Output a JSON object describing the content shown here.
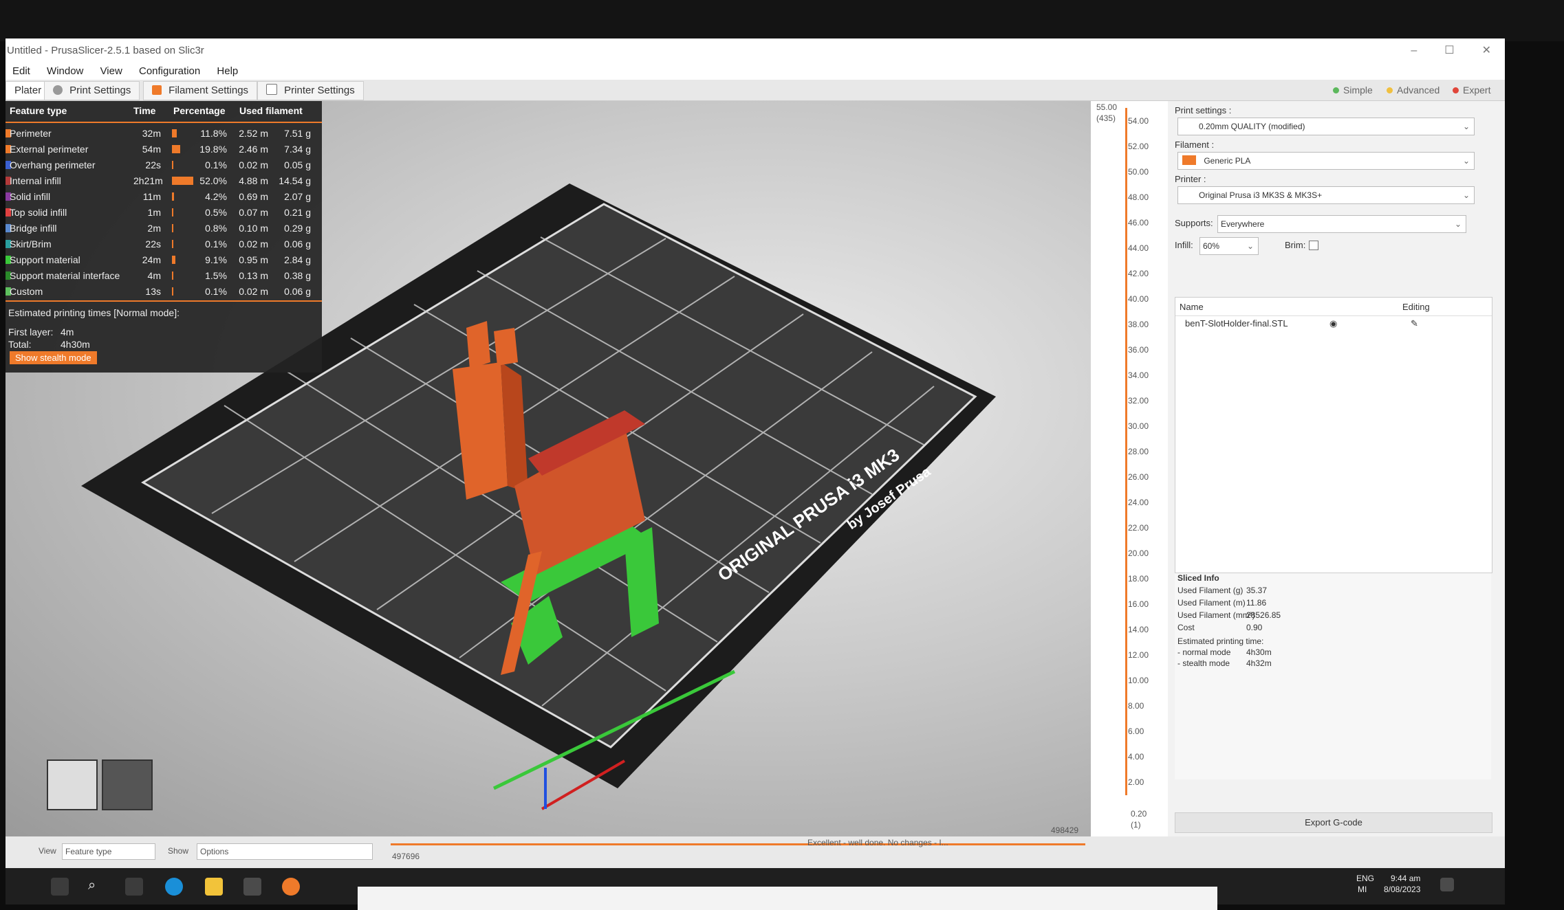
{
  "window": {
    "title": "Untitled - PrusaSlicer-2.5.1 based on Slic3r",
    "controls": [
      "–",
      "☐",
      "✕"
    ]
  },
  "menu": [
    "Edit",
    "Window",
    "View",
    "Configuration",
    "Help"
  ],
  "tabs": {
    "plater": "Plater",
    "print_settings": "Print Settings",
    "filament_settings": "Filament Settings",
    "printer_settings": "Printer Settings"
  },
  "modes": {
    "simple": "Simple",
    "advanced": "Advanced",
    "expert": "Expert",
    "colors": {
      "simple": "#5cb85c",
      "advanced": "#f0c040",
      "expert": "#e0463a"
    }
  },
  "stats": {
    "headers": {
      "type": "Feature type",
      "time": "Time",
      "percentage": "Percentage",
      "used_filament": "Used filament"
    },
    "rows": [
      {
        "name": "Perimeter",
        "time": "32m",
        "pct": "11.8%",
        "pct_value": 11.8,
        "len": "2.52 m",
        "wt": "7.51 g",
        "color": "#ef7a2a"
      },
      {
        "name": "External perimeter",
        "time": "54m",
        "pct": "19.8%",
        "pct_value": 19.8,
        "len": "2.46 m",
        "wt": "7.34 g",
        "color": "#ef7a2a"
      },
      {
        "name": "Overhang perimeter",
        "time": "22s",
        "pct": "0.1%",
        "pct_value": 0.1,
        "len": "0.02 m",
        "wt": "0.05 g",
        "color": "#3a5fd0"
      },
      {
        "name": "Internal infill",
        "time": "2h21m",
        "pct": "52.0%",
        "pct_value": 52.0,
        "len": "4.88 m",
        "wt": "14.54 g",
        "color": "#b33a3a"
      },
      {
        "name": "Solid infill",
        "time": "11m",
        "pct": "4.2%",
        "pct_value": 4.2,
        "len": "0.69 m",
        "wt": "2.07 g",
        "color": "#8a3aa0"
      },
      {
        "name": "Top solid infill",
        "time": "1m",
        "pct": "0.5%",
        "pct_value": 0.5,
        "len": "0.07 m",
        "wt": "0.21 g",
        "color": "#e04040"
      },
      {
        "name": "Bridge infill",
        "time": "2m",
        "pct": "0.8%",
        "pct_value": 0.8,
        "len": "0.10 m",
        "wt": "0.29 g",
        "color": "#5a8ad0"
      },
      {
        "name": "Skirt/Brim",
        "time": "22s",
        "pct": "0.1%",
        "pct_value": 0.1,
        "len": "0.02 m",
        "wt": "0.06 g",
        "color": "#2aa0a0"
      },
      {
        "name": "Support material",
        "time": "24m",
        "pct": "9.1%",
        "pct_value": 9.1,
        "len": "0.95 m",
        "wt": "2.84 g",
        "color": "#3ac83a"
      },
      {
        "name": "Support material interface",
        "time": "4m",
        "pct": "1.5%",
        "pct_value": 1.5,
        "len": "0.13 m",
        "wt": "0.38 g",
        "color": "#2a8a2a"
      },
      {
        "name": "Custom",
        "time": "13s",
        "pct": "0.1%",
        "pct_value": 0.1,
        "len": "0.02 m",
        "wt": "0.06 g",
        "color": "#5ec05e"
      }
    ],
    "est_title": "Estimated printing times [Normal mode]:",
    "first_layer_label": "First layer:",
    "first_layer_value": "4m",
    "total_label": "Total:",
    "total_value": "4h30m",
    "stealth_button": "Show stealth mode"
  },
  "bed": {
    "line1": "ORIGINAL PRUSA i3 MK3",
    "line2": "by Josef Prusa"
  },
  "ruler": {
    "top_value": "55.00",
    "top_layer": "(435)",
    "ticks": [
      "54.00",
      "52.00",
      "50.00",
      "48.00",
      "46.00",
      "44.00",
      "42.00",
      "40.00",
      "38.00",
      "36.00",
      "34.00",
      "32.00",
      "30.00",
      "28.00",
      "26.00",
      "24.00",
      "22.00",
      "20.00",
      "18.00",
      "16.00",
      "14.00",
      "12.00",
      "10.00",
      "8.00",
      "6.00",
      "4.00",
      "2.00"
    ],
    "bottom_value": "0.20",
    "bottom_layer": "(1)"
  },
  "right_panel": {
    "print_settings_label": "Print settings :",
    "print_settings_value": "0.20mm QUALITY (modified)",
    "filament_label": "Filament :",
    "filament_value": "Generic PLA",
    "filament_color": "#ef7a2a",
    "printer_label": "Printer :",
    "printer_value": "Original Prusa i3 MK3S & MK3S+",
    "supports_label": "Supports:",
    "supports_value": "Everywhere",
    "infill_label": "Infill:",
    "infill_value": "60%",
    "brim_label": "Brim:",
    "list_header_name": "Name",
    "list_header_editing": "Editing",
    "object_name": "benT-SlotHolder-final.STL",
    "sliced_info_title": "Sliced Info",
    "sliced_info": [
      {
        "k": "Used Filament (g)",
        "v": "35.37"
      },
      {
        "k": "Used Filament (m)",
        "v": "11.86"
      },
      {
        "k": "Used Filament (mm³)",
        "v": "28526.85"
      },
      {
        "k": "Cost",
        "v": "0.90"
      }
    ],
    "est_label": "Estimated printing time:",
    "normal_label": "- normal mode",
    "normal_value": "4h30m",
    "stealth_label": "- stealth mode",
    "stealth_value": "4h32m",
    "export_button": "Export G-code"
  },
  "bottom": {
    "view_label": "View",
    "view_value": "Feature type",
    "show_label": "Show",
    "show_value": "Options",
    "slider_left": "497696",
    "slider_right": "498429",
    "status_text": "Excellent - well done. No changes - I..."
  },
  "taskbar": {
    "lang": "ENG",
    "lang2": "MI",
    "time": "9:44 am",
    "date": "8/08/2023"
  }
}
